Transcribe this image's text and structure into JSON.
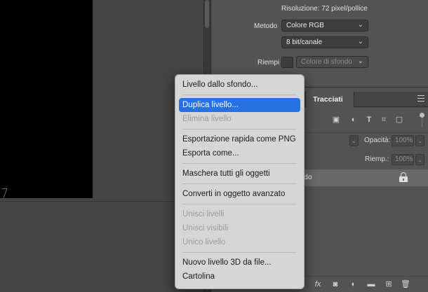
{
  "properties": {
    "resolution": "Risoluzione: 72 pixel/pollice",
    "metodo_label": "Metodo",
    "metodo_value": "Colore RGB",
    "bit_value": "8 bit/canale",
    "riempi_label": "Riempi",
    "riempi_value": "Colore di sfondo"
  },
  "layers_panel": {
    "tab_tracciati": "Tracciati",
    "opacity_label": "Opacità:",
    "opacity_value": "100%",
    "fill_label": "Riemp.:",
    "fill_value": "100%",
    "layer_name_partial": "do"
  },
  "context_menu": {
    "groups": [
      [
        {
          "label": "Livello dallo sfondo...",
          "state": "enabled"
        }
      ],
      [
        {
          "label": "Duplica livello...",
          "state": "selected"
        },
        {
          "label": "Elimina livello",
          "state": "disabled"
        }
      ],
      [
        {
          "label": "Esportazione rapida come PNG",
          "state": "enabled"
        },
        {
          "label": "Esporta come...",
          "state": "enabled"
        }
      ],
      [
        {
          "label": "Maschera tutti gli oggetti",
          "state": "enabled"
        }
      ],
      [
        {
          "label": "Converti in oggetto avanzato",
          "state": "enabled"
        }
      ],
      [
        {
          "label": "Unisci livelli",
          "state": "disabled"
        },
        {
          "label": "Unisci visibili",
          "state": "disabled"
        },
        {
          "label": "Unico livello",
          "state": "disabled"
        }
      ],
      [
        {
          "label": "Nuovo livello 3D da file...",
          "state": "enabled"
        },
        {
          "label": "Cartolina",
          "state": "enabled"
        }
      ]
    ]
  },
  "colors": {
    "selection": "#2871e4",
    "menu_bg": "#d6d6d6",
    "panel_bg": "#535353",
    "canvas_bg": "#454545"
  }
}
